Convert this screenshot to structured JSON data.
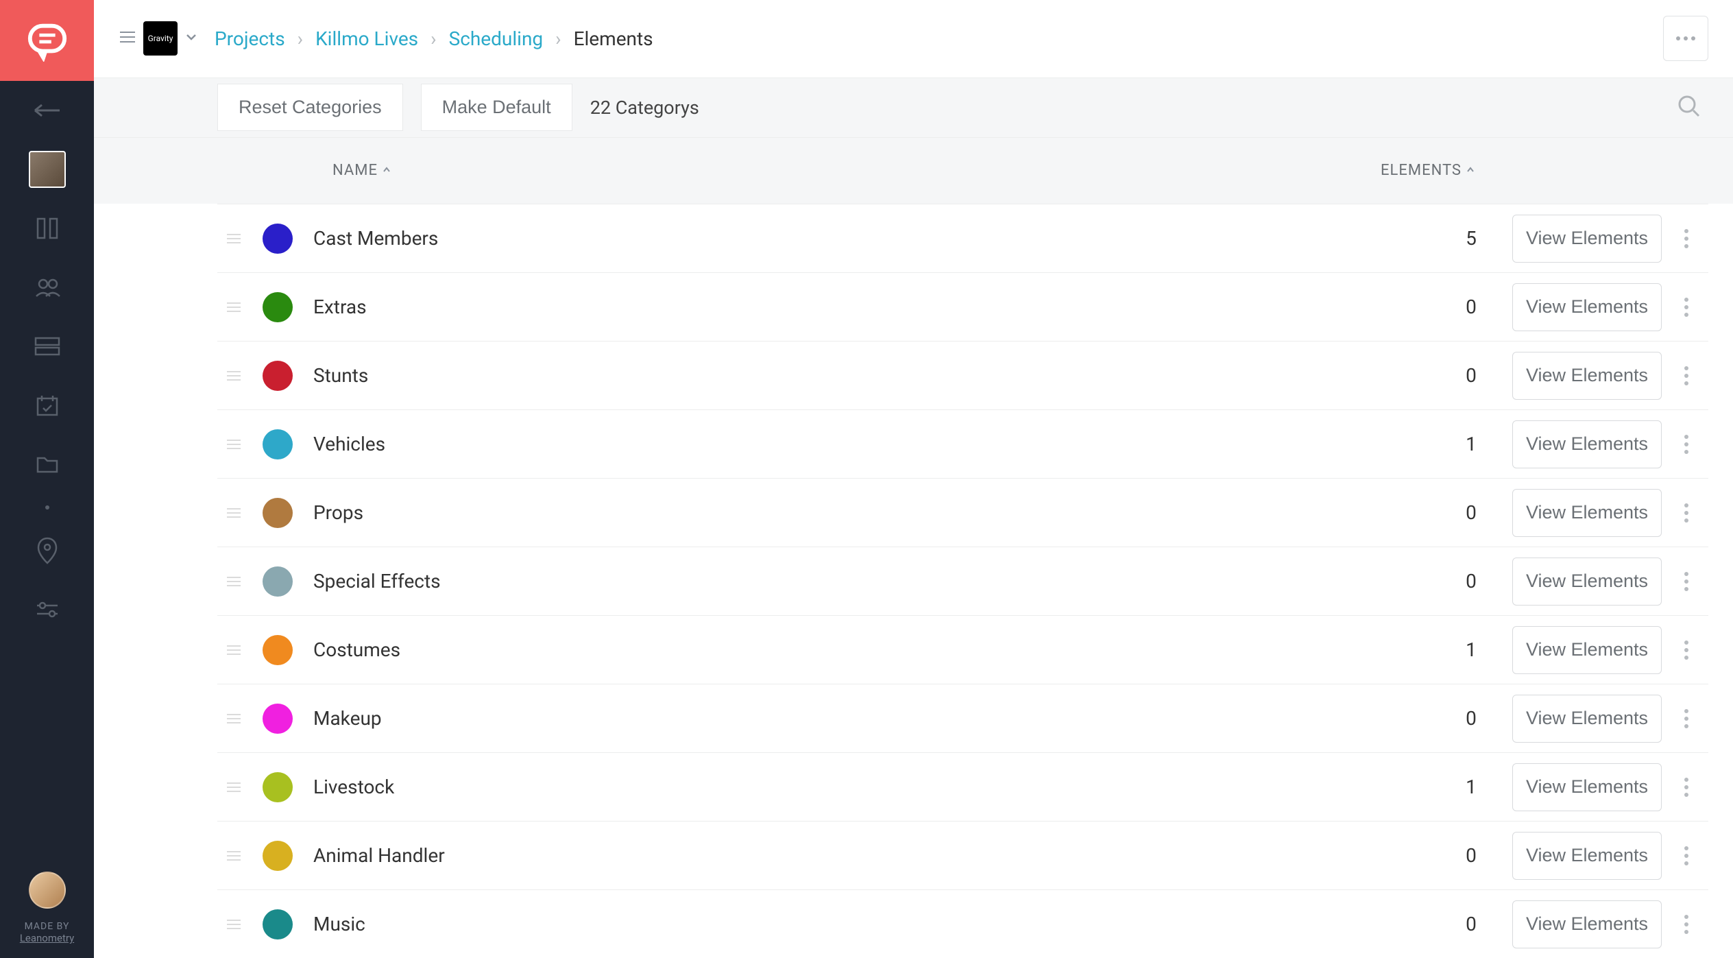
{
  "sidebar": {
    "made_by_label": "MADE BY",
    "made_by_name": "Leanometry"
  },
  "topbar": {
    "project_logo_text": "Gravity",
    "breadcrumb": {
      "projects": "Projects",
      "project_name": "Killmo Lives",
      "scheduling": "Scheduling",
      "current": "Elements"
    }
  },
  "actions": {
    "reset_label": "Reset Categories",
    "make_default_label": "Make Default",
    "count_label": "22 Categorys"
  },
  "table": {
    "header_name": "NAME",
    "header_elements": "ELEMENTS",
    "view_button_label": "View Elements",
    "rows": [
      {
        "name": "Cast Members",
        "count": "5",
        "color": "#2a1fc9"
      },
      {
        "name": "Extras",
        "count": "0",
        "color": "#2a8a0f"
      },
      {
        "name": "Stunts",
        "count": "0",
        "color": "#c91f2f"
      },
      {
        "name": "Vehicles",
        "count": "1",
        "color": "#2ea8c9"
      },
      {
        "name": "Props",
        "count": "0",
        "color": "#b07a3f"
      },
      {
        "name": "Special Effects",
        "count": "0",
        "color": "#8aa8b0"
      },
      {
        "name": "Costumes",
        "count": "1",
        "color": "#f08a1f"
      },
      {
        "name": "Makeup",
        "count": "0",
        "color": "#f020e0"
      },
      {
        "name": "Livestock",
        "count": "1",
        "color": "#a8c020"
      },
      {
        "name": "Animal Handler",
        "count": "0",
        "color": "#d8b020"
      },
      {
        "name": "Music",
        "count": "0",
        "color": "#1a8a8a"
      }
    ]
  }
}
